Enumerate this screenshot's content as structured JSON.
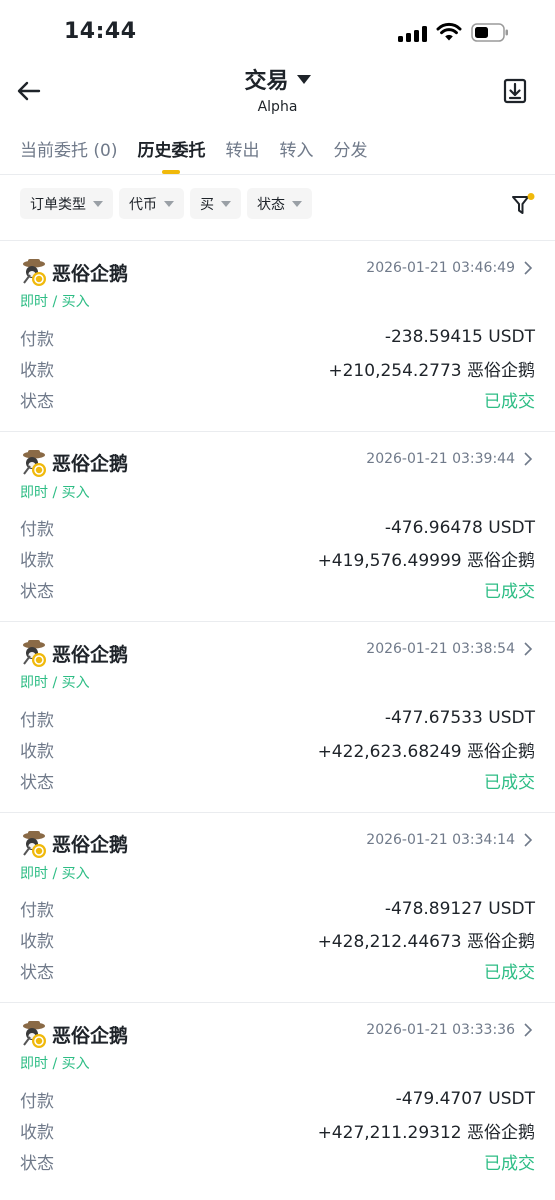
{
  "status_bar": {
    "time": "14:44"
  },
  "header": {
    "title": "交易",
    "subtitle": "Alpha"
  },
  "tabs": [
    {
      "label": "当前委托 (0)",
      "active": false
    },
    {
      "label": "历史委托",
      "active": true
    },
    {
      "label": "转出",
      "active": false
    },
    {
      "label": "转入",
      "active": false
    },
    {
      "label": "分发",
      "active": false
    }
  ],
  "filters": [
    {
      "label": "订单类型"
    },
    {
      "label": "代币"
    },
    {
      "label": "买"
    },
    {
      "label": "状态"
    }
  ],
  "labels": {
    "pay": "付款",
    "receive": "收款",
    "status": "状态"
  },
  "orders": [
    {
      "token": "恶俗企鹅",
      "time": "2026-01-21 03:46:49",
      "type": "即时 / 买入",
      "pay": "-238.59415 USDT",
      "receive": "+210,254.2773 恶俗企鹅",
      "status": "已成交"
    },
    {
      "token": "恶俗企鹅",
      "time": "2026-01-21 03:39:44",
      "type": "即时 / 买入",
      "pay": "-476.96478 USDT",
      "receive": "+419,576.49999 恶俗企鹅",
      "status": "已成交"
    },
    {
      "token": "恶俗企鹅",
      "time": "2026-01-21 03:38:54",
      "type": "即时 / 买入",
      "pay": "-477.67533 USDT",
      "receive": "+422,623.68249 恶俗企鹅",
      "status": "已成交"
    },
    {
      "token": "恶俗企鹅",
      "time": "2026-01-21 03:34:14",
      "type": "即时 / 买入",
      "pay": "-478.89127 USDT",
      "receive": "+428,212.44673 恶俗企鹅",
      "status": "已成交"
    },
    {
      "token": "恶俗企鹅",
      "time": "2026-01-21 03:33:36",
      "type": "即时 / 买入",
      "pay": "-479.4707 USDT",
      "receive": "+427,211.29312 恶俗企鹅",
      "status": "已成交"
    }
  ],
  "colors": {
    "accent": "#f0b90b",
    "green": "#2ebd85",
    "muted": "#707a8a",
    "text": "#1e2329"
  },
  "icons": [
    "back-arrow-icon",
    "caret-down-icon",
    "download-icon",
    "filter-icon",
    "chevron-right-icon",
    "token-avatar-icon"
  ]
}
